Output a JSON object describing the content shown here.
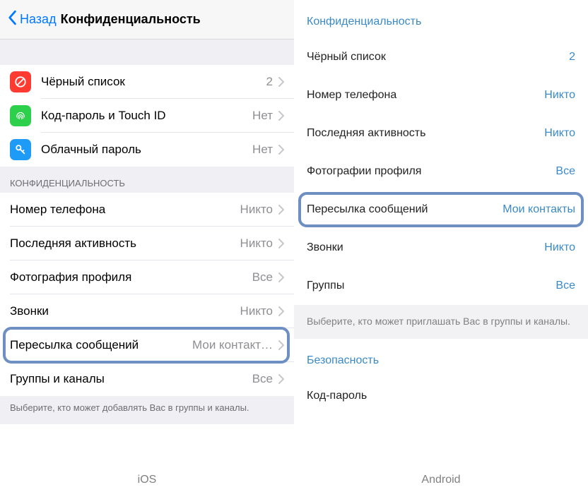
{
  "ios": {
    "back": "Назад",
    "title": "Конфиденциальность",
    "group1": [
      {
        "icon": "block",
        "label": "Чёрный список",
        "value": "2"
      },
      {
        "icon": "touchid",
        "label": "Код-пароль и Touch ID",
        "value": "Нет"
      },
      {
        "icon": "key",
        "label": "Облачный пароль",
        "value": "Нет"
      }
    ],
    "section2_header": "КОНФИДЕНЦИАЛЬНОСТЬ",
    "group2": [
      {
        "label": "Номер телефона",
        "value": "Никто"
      },
      {
        "label": "Последняя активность",
        "value": "Никто"
      },
      {
        "label": "Фотография профиля",
        "value": "Все"
      },
      {
        "label": "Звонки",
        "value": "Никто"
      },
      {
        "label": "Пересылка сообщений",
        "value": "Мои контакт…",
        "highlighted": true
      },
      {
        "label": "Группы и каналы",
        "value": "Все"
      }
    ],
    "footer": "Выберите, кто может добавлять Вас в группы и каналы.",
    "platform": "iOS"
  },
  "android": {
    "header1": "Конфиденциальность",
    "rows1": [
      {
        "label": "Чёрный список",
        "value": "2"
      },
      {
        "label": "Номер телефона",
        "value": "Никто"
      },
      {
        "label": "Последняя активность",
        "value": "Никто"
      },
      {
        "label": "Фотографии профиля",
        "value": "Все"
      },
      {
        "label": "Пересылка сообщений",
        "value": "Мои контакты",
        "highlighted": true
      },
      {
        "label": "Звонки",
        "value": "Никто"
      },
      {
        "label": "Группы",
        "value": "Все"
      }
    ],
    "footer1": "Выберите, кто может приглашать Вас в группы и каналы.",
    "header2": "Безопасность",
    "rows2": [
      {
        "label": "Код-пароль",
        "value": ""
      }
    ],
    "platform": "Android"
  }
}
